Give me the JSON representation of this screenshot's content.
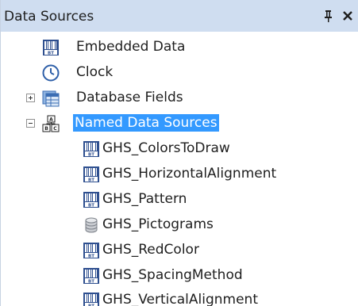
{
  "panel": {
    "title": "Data Sources",
    "pin_glyph": "📌",
    "close_glyph": "✕"
  },
  "tree": {
    "top_items": [
      {
        "label": "Embedded Data",
        "icon": "bt-data-icon"
      },
      {
        "label": "Clock",
        "icon": "clock-icon"
      },
      {
        "label": "Database Fields",
        "icon": "database-table-icon",
        "expander": "collapsed"
      },
      {
        "label": "Named Data Sources",
        "icon": "named-sources-icon",
        "expander": "expanded",
        "selected": true
      }
    ],
    "children": [
      {
        "label": "GHS_ColorsToDraw",
        "icon": "bt-data-icon"
      },
      {
        "label": "GHS_HorizontalAlignment",
        "icon": "bt-data-icon"
      },
      {
        "label": "GHS_Pattern",
        "icon": "bt-data-icon"
      },
      {
        "label": "GHS_Pictograms",
        "icon": "database-cylinder-icon"
      },
      {
        "label": "GHS_RedColor",
        "icon": "bt-data-icon"
      },
      {
        "label": "GHS_SpacingMethod",
        "icon": "bt-data-icon"
      },
      {
        "label": "GHS_VerticalAlignment",
        "icon": "bt-data-icon"
      }
    ]
  },
  "colors": {
    "titlebar": "#cfddf0",
    "selection": "#3399ff",
    "icon_blue": "#2e4f8f"
  }
}
